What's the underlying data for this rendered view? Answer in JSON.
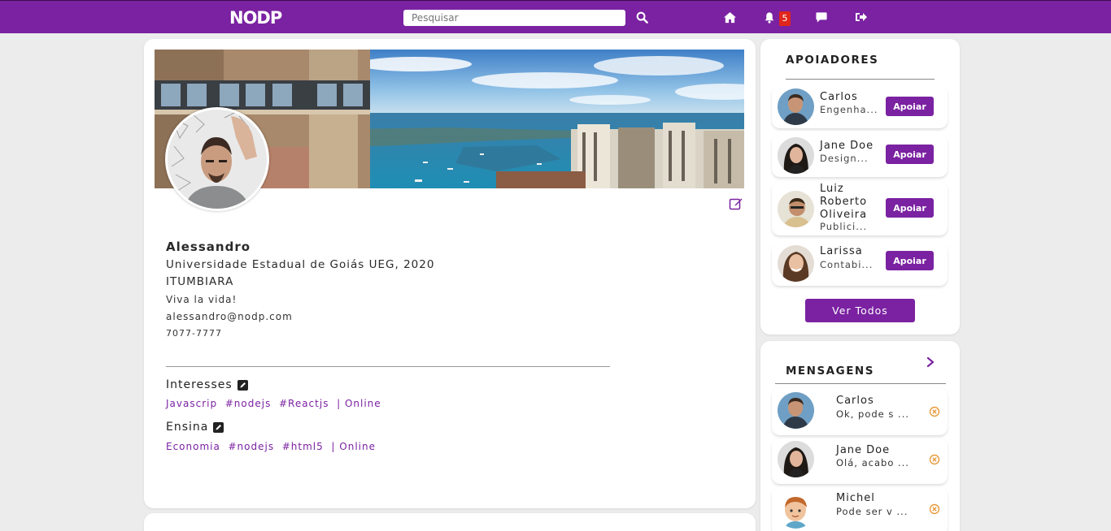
{
  "nav": {
    "logo": "NODP",
    "search_placeholder": "Pesquisar",
    "search_value": "",
    "icons": [
      "search-icon",
      "home-icon",
      "bell-icon",
      "chat-icon",
      "logout-icon"
    ],
    "notification_count": "5",
    "accent": "#7a22a1"
  },
  "profile": {
    "name": "Alessandro",
    "university": "Universidade Estadual de Goiás UEG, 2020",
    "city": "ITUMBIARA",
    "bio": "Viva la vida!",
    "email": "alessandro@nodp.com",
    "phone": "7077-7777",
    "interests": {
      "title": "Interesses",
      "tags": [
        "Javascrip",
        "#nodejs",
        "#Reactjs"
      ],
      "mode": "| Online"
    },
    "teaches": {
      "title": "Ensina",
      "tags": [
        "Economia",
        "#nodejs",
        "#html5"
      ],
      "mode": "| Online"
    }
  },
  "supporters": {
    "title": "APOIADORES",
    "button_label": "Apoiar",
    "view_all_label": "Ver Todos",
    "items": [
      {
        "name": "Carlos",
        "sub": "Engenha..."
      },
      {
        "name": "Jane Doe",
        "sub": "Design..."
      },
      {
        "name": "Luiz Roberto Oliveira",
        "name_lines": [
          "Luiz",
          "Roberto",
          "Oliveira"
        ],
        "sub": "Publici..."
      },
      {
        "name": "Larissa",
        "sub": "Contabi..."
      }
    ]
  },
  "messages": {
    "title": "MENSAGENS",
    "items": [
      {
        "name": "Carlos",
        "preview": "Ok, pode s ..."
      },
      {
        "name": "Jane Doe",
        "preview": "Olá, acabo ..."
      },
      {
        "name": "Michel",
        "preview": "Pode ser v ..."
      }
    ]
  }
}
